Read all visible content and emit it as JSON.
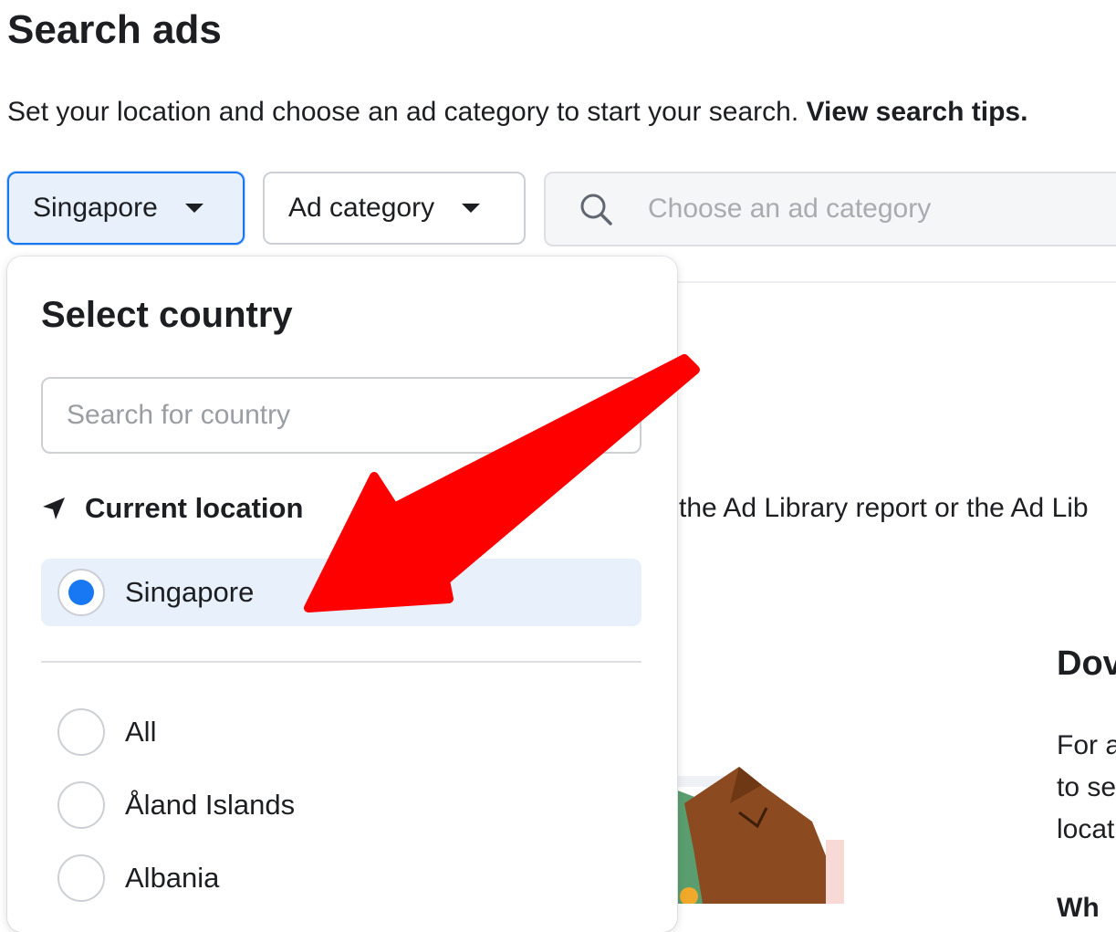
{
  "page": {
    "title": "Search ads",
    "subtitle_text": "Set your location and choose an ad category to start your search. ",
    "subtitle_link": "View search tips."
  },
  "filters": {
    "country_button": "Singapore",
    "category_button": "Ad category",
    "search_placeholder": "Choose an ad category"
  },
  "background": {
    "ad_library_text": "the Ad Library report or the Ad Lib",
    "heading_partial": "Dov",
    "para_lines": [
      "For a",
      "to se",
      "locat"
    ],
    "bold_partial": "Wh"
  },
  "country_dropdown": {
    "title": "Select country",
    "search_placeholder": "Search for country",
    "current_location_label": "Current location",
    "current_location_option": "Singapore",
    "options": [
      "All",
      "Åland Islands",
      "Albania"
    ]
  },
  "colors": {
    "accent": "#1877f2",
    "annotation_arrow": "#ff0000"
  }
}
